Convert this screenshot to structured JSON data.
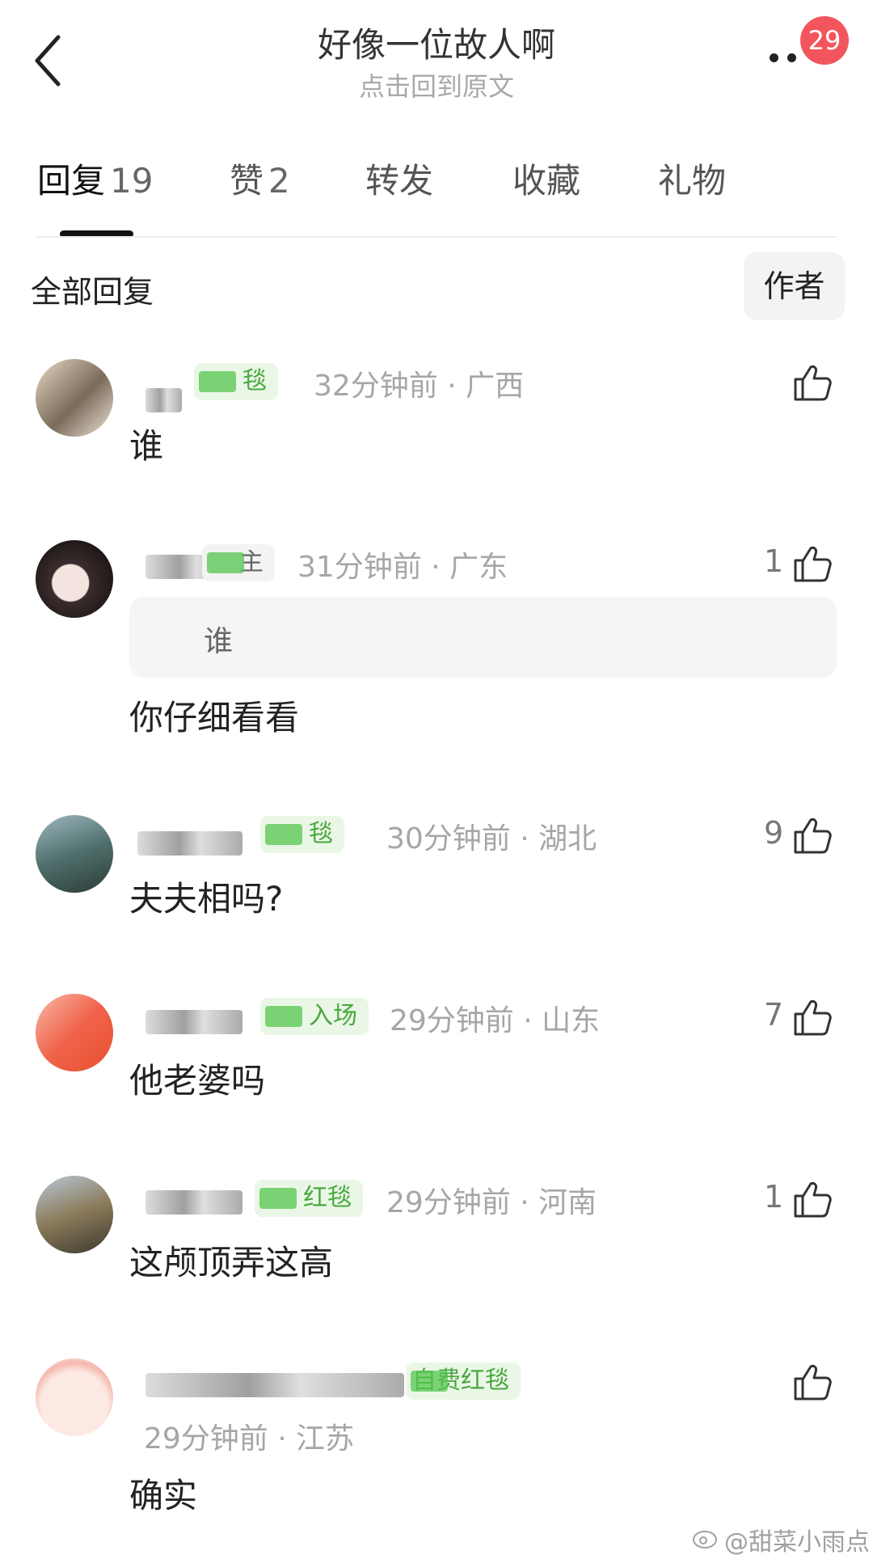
{
  "header": {
    "title": "好像一位故人啊",
    "subtitle": "点击回到原文",
    "badge": "29"
  },
  "tabs": [
    {
      "label": "回复",
      "count": "19"
    },
    {
      "label": "赞",
      "count": "2"
    },
    {
      "label": "转发",
      "count": ""
    },
    {
      "label": "收藏",
      "count": ""
    },
    {
      "label": "礼物",
      "count": ""
    }
  ],
  "section": {
    "title": "全部回复",
    "author_button": "作者"
  },
  "comments": [
    {
      "tag": "毯",
      "meta": "32分钟前 · 广西",
      "likes": "",
      "quote": "",
      "text": "谁"
    },
    {
      "tag": "主",
      "meta": "31分钟前 · 广东",
      "likes": "1",
      "quote": "谁",
      "text": "你仔细看看"
    },
    {
      "tag": "毯",
      "meta": "30分钟前 · 湖北",
      "likes": "9",
      "quote": "",
      "text": "夫夫相吗?"
    },
    {
      "tag": "入场",
      "meta": "29分钟前 · 山东",
      "likes": "7",
      "quote": "",
      "text": "他老婆吗"
    },
    {
      "tag": "红毯",
      "meta": "29分钟前 · 河南",
      "likes": "1",
      "quote": "",
      "text": "这颅顶弄这高"
    },
    {
      "tag": "自费红毯",
      "meta": "29分钟前 · 江苏",
      "likes": "",
      "quote": "",
      "text": "确实"
    }
  ],
  "watermark": "@甜菜小雨点",
  "colors": {
    "badge": "#f2565c",
    "tag_bg": "#eaf7e6",
    "tag_text": "#4aa840",
    "meta": "#a6a6a6"
  }
}
